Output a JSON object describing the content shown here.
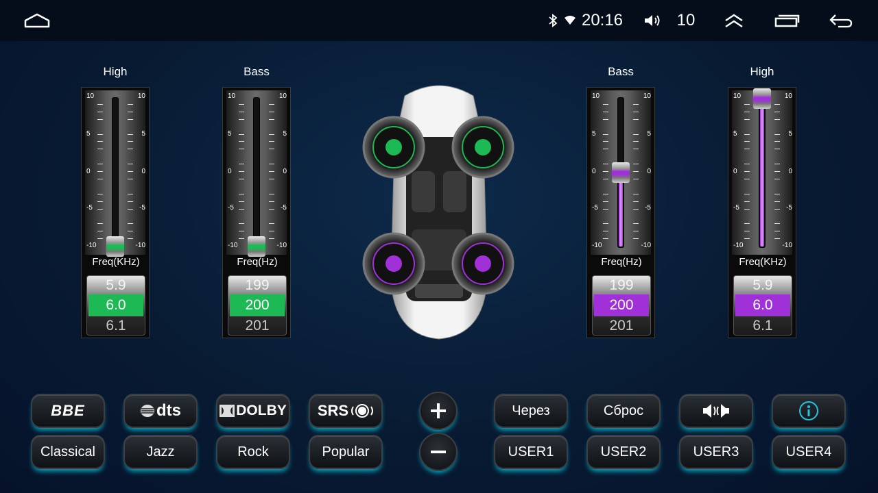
{
  "status": {
    "time": "20:16",
    "volume": "10"
  },
  "panels": [
    {
      "title": "High",
      "freq_label": "Freq(KHz)",
      "prev": "5.9",
      "current": "6.0",
      "next": "6.1",
      "level": -10,
      "color": "#1db954"
    },
    {
      "title": "Bass",
      "freq_label": "Freq(Hz)",
      "prev": "199",
      "current": "200",
      "next": "201",
      "level": -10,
      "color": "#1db954"
    },
    {
      "title": "Bass",
      "freq_label": "Freq(Hz)",
      "prev": "199",
      "current": "200",
      "next": "201",
      "level": 0,
      "color": "#a030d8"
    },
    {
      "title": "High",
      "freq_label": "Freq(KHz)",
      "prev": "5.9",
      "current": "6.0",
      "next": "6.1",
      "level": 10,
      "color": "#a030d8"
    }
  ],
  "scale": {
    "top": "10",
    "mid_top": "5",
    "mid": "0",
    "mid_bot": "-5",
    "bottom": "-10"
  },
  "effects": {
    "bbe": "BBE",
    "dts": "dts",
    "dolby": "DOLBY",
    "srs": "SRS"
  },
  "presets": {
    "classical": "Classical",
    "jazz": "Jazz",
    "rock": "Rock",
    "popular": "Popular"
  },
  "actions": {
    "via": "Через",
    "reset": "Сброс"
  },
  "users": {
    "u1": "USER1",
    "u2": "USER2",
    "u3": "USER3",
    "u4": "USER4"
  },
  "colors": {
    "front_speaker": "#1db954",
    "rear_speaker": "#a030d8",
    "glow": "#00d2e6"
  }
}
